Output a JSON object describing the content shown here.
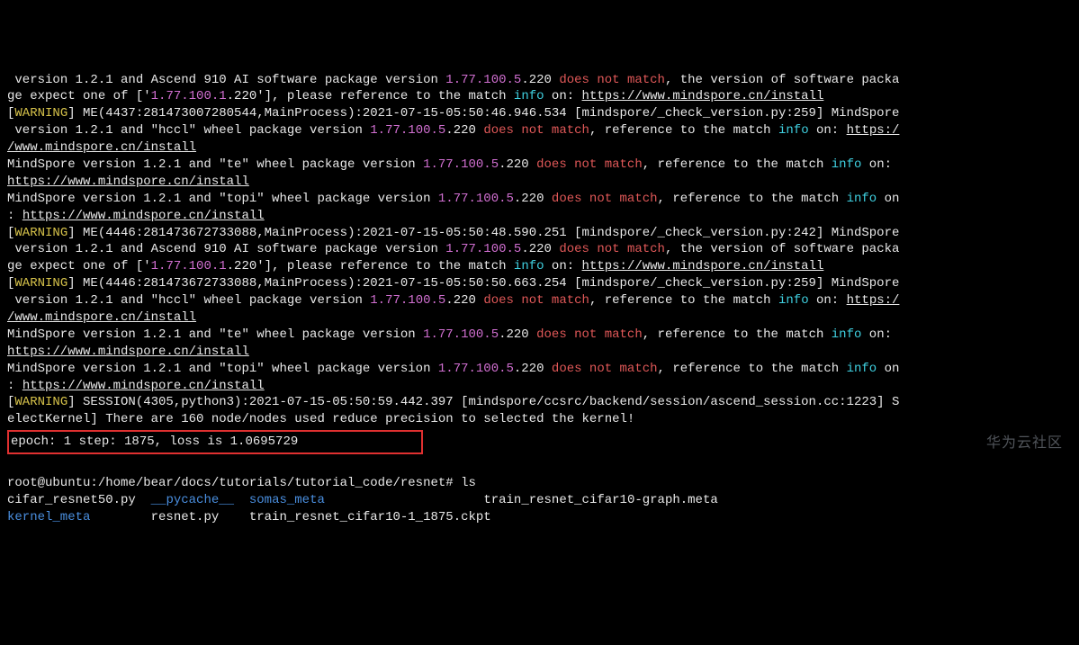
{
  "lines": {
    "l1a": " version 1.2.1 and Ascend 910 AI software package version ",
    "l1b": "1.77.100.5",
    "l1c": ".220 ",
    "l1d": "does not match",
    "l1e": ", the version of software packa",
    "l2a": "ge expect one of ['",
    "l2b": "1.77.100.1",
    "l2c": ".220'], please reference to the match ",
    "l2d": "info",
    "l2e": " on: ",
    "l2f": "https://www.mindspore.cn/install",
    "l3a": "[",
    "l3b": "WARNING",
    "l3c": "] ME(4437:281473007280544,MainProcess):2021-07-15-05:50:46.946.534 [mindspore/_check_version.py:259] MindSpore",
    "l4a": " version 1.2.1 and \"hccl\" wheel package version ",
    "l4b": "1.77.100.5",
    "l4c": ".220 ",
    "l4d": "does not match",
    "l4e": ", reference to the match ",
    "l4f": "info",
    "l4g": " on: ",
    "l4h": "https:/",
    "l5a": "/www.mindspore.cn/install",
    "l6a": "MindSpore version 1.2.1 and \"te\" wheel package version ",
    "l6b": "1.77.100.5",
    "l6c": ".220 ",
    "l6d": "does not match",
    "l6e": ", reference to the match ",
    "l6f": "info",
    "l6g": " on: ",
    "l7a": "https://www.mindspore.cn/install",
    "l8a": "MindSpore version 1.2.1 and \"topi\" wheel package version ",
    "l8b": "1.77.100.5",
    "l8c": ".220 ",
    "l8d": "does not match",
    "l8e": ", reference to the match ",
    "l8f": "info",
    "l8g": " on",
    "l9a": ": ",
    "l9b": "https://www.mindspore.cn/install",
    "l10a": "[",
    "l10b": "WARNING",
    "l10c": "] ME(4446:281473672733088,MainProcess):2021-07-15-05:50:48.590.251 [mindspore/_check_version.py:242] MindSpore",
    "l11a": " version 1.2.1 and Ascend 910 AI software package version ",
    "l11b": "1.77.100.5",
    "l11c": ".220 ",
    "l11d": "does not match",
    "l11e": ", the version of software packa",
    "l12a": "ge expect one of ['",
    "l12b": "1.77.100.1",
    "l12c": ".220'], please reference to the match ",
    "l12d": "info",
    "l12e": " on: ",
    "l12f": "https://www.mindspore.cn/install",
    "l13a": "[",
    "l13b": "WARNING",
    "l13c": "] ME(4446:281473672733088,MainProcess):2021-07-15-05:50:50.663.254 [mindspore/_check_version.py:259] MindSpore",
    "l14a": " version 1.2.1 and \"hccl\" wheel package version ",
    "l14b": "1.77.100.5",
    "l14c": ".220 ",
    "l14d": "does not match",
    "l14e": ", reference to the match ",
    "l14f": "info",
    "l14g": " on: ",
    "l14h": "https:/",
    "l15a": "/www.mindspore.cn/install",
    "l16a": "MindSpore version 1.2.1 and \"te\" wheel package version ",
    "l16b": "1.77.100.5",
    "l16c": ".220 ",
    "l16d": "does not match",
    "l16e": ", reference to the match ",
    "l16f": "info",
    "l16g": " on: ",
    "l17a": "https://www.mindspore.cn/install",
    "l18a": "MindSpore version 1.2.1 and \"topi\" wheel package version ",
    "l18b": "1.77.100.5",
    "l18c": ".220 ",
    "l18d": "does not match",
    "l18e": ", reference to the match ",
    "l18f": "info",
    "l18g": " on",
    "l19a": ": ",
    "l19b": "https://www.mindspore.cn/install",
    "l20a": "[",
    "l20b": "WARNING",
    "l20c": "] SESSION(4305,python3):2021-07-15-05:50:59.442.397 [mindspore/ccsrc/backend/session/ascend_session.cc:1223] S",
    "l21a": "electKernel] There are 160 node/nodes used reduce precision to selected the kernel!",
    "l22": "epoch: 1 step: 1875, loss is 1.0695729                ",
    "l24": "root@ubuntu:/home/bear/docs/tutorials/tutorial_code/resnet# ls",
    "l25a": "cifar_resnet50.py  ",
    "l25b": "__pycache__",
    "l25c": "  ",
    "l25d": "somas_meta",
    "l25e": "                     train_resnet_cifar10-graph.meta",
    "l26a": "kernel_meta",
    "l26b": "        resnet.py    train_resnet_cifar10-1_1875.ckpt"
  },
  "watermark": "华为云社区"
}
